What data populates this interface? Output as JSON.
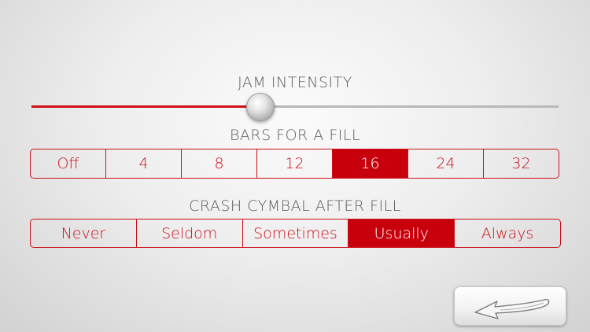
{
  "jam_intensity": {
    "title": "JAM INTENSITY",
    "value_fraction": 0.435,
    "active_color": "#d0101a",
    "track_color": "#b9b9b9"
  },
  "bars_for_fill": {
    "title": "BARS FOR A FILL",
    "options": [
      "Off",
      "4",
      "8",
      "12",
      "16",
      "24",
      "32"
    ],
    "selected": "16"
  },
  "crash_cymbal": {
    "title": "CRASH CYMBAL AFTER FILL",
    "options": [
      "Never",
      "Seldom",
      "Sometimes",
      "Usually",
      "Always"
    ],
    "selected": "Usually"
  },
  "accent_color": "#c8101c",
  "back_button": {
    "icon": "back-arrow-icon"
  }
}
